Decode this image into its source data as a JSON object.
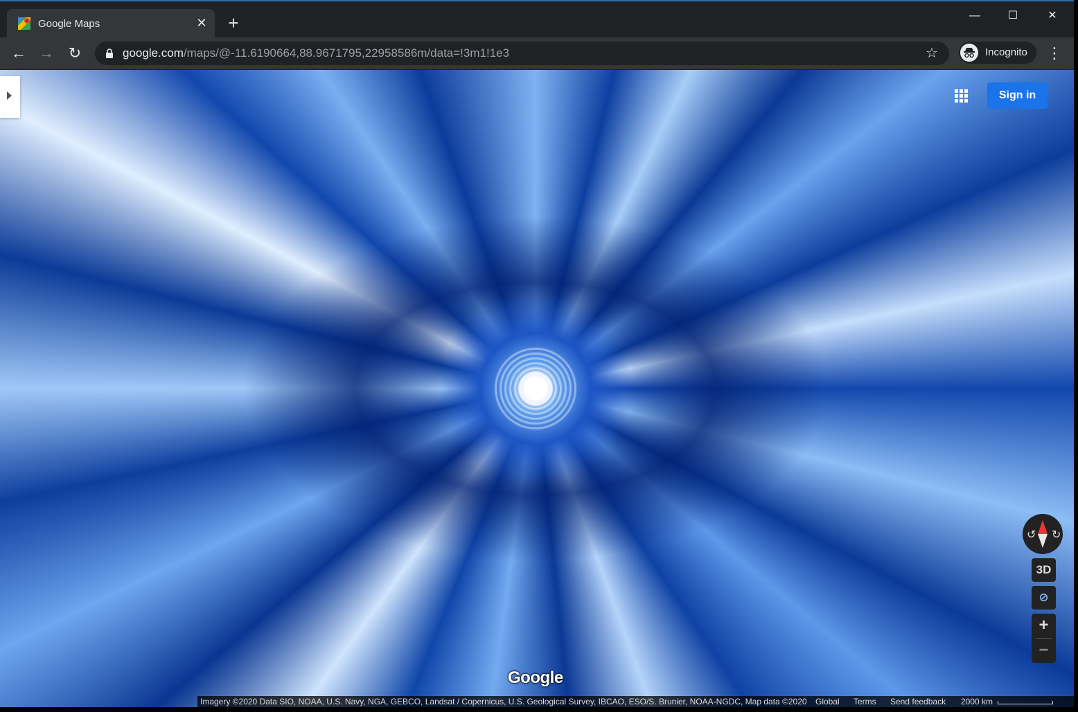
{
  "browser": {
    "tab": {
      "title": "Google Maps",
      "close_glyph": "✕"
    },
    "new_tab_glyph": "+",
    "window_controls": {
      "minimize": "—",
      "maximize": "☐",
      "close": "✕"
    },
    "nav": {
      "back": "←",
      "forward": "→",
      "reload": "↻"
    },
    "url_host": "google.com",
    "url_path": "/maps/@-11.6190664,88.9671795,22958586m/data=!3m1!1e3",
    "star_glyph": "☆",
    "profile_label": "Incognito",
    "menu_glyph": "⋮"
  },
  "map": {
    "sign_in_label": "Sign in",
    "compass": {
      "rotate_left": "↺",
      "rotate_right": "↻"
    },
    "btn_3d": "3D",
    "btn_layer": "⊘",
    "zoom_in": "+",
    "zoom_out": "−",
    "logo_text": "Google",
    "footer": {
      "attribution": "Imagery ©2020 Data SIO, NOAA, U.S. Navy, NGA, GEBCO, Landsat / Copernicus, U.S. Geological Survey, IBCAO, ESO/S. Brunier, NOAA-NGDC, Map data ©2020",
      "region": "Global",
      "terms": "Terms",
      "feedback": "Send feedback",
      "scale": "2000 km"
    }
  },
  "colors": {
    "chrome_dark": "#202124",
    "chrome_toolbar": "#35363a",
    "signin_blue": "#1a73e8",
    "compass_red": "#e53935"
  }
}
